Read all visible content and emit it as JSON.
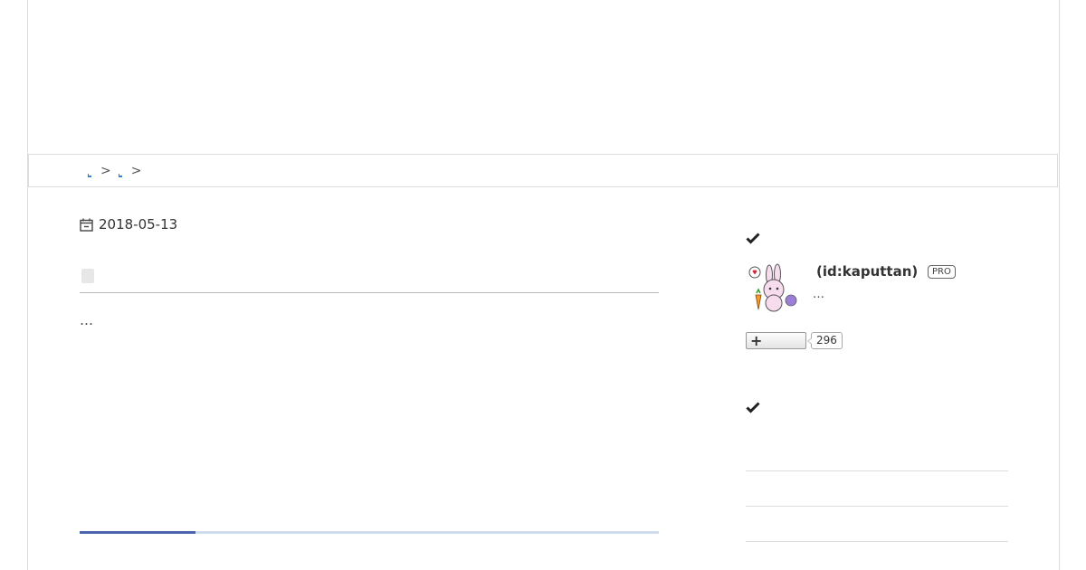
{
  "breadcrumb": {
    "items": [
      {
        "label": "",
        "separator": ">"
      },
      {
        "label": "",
        "separator": ">"
      }
    ]
  },
  "article": {
    "date": "2018-05-13",
    "excerpt": "…",
    "read_progress": 0.2
  },
  "sidebar": {
    "profile_section_icon": "check-icon",
    "profile": {
      "id_text": "(id:kaputtan)",
      "badge": "PRO",
      "description": "…",
      "follow_count": "296",
      "follow_icon": "plus-icon"
    },
    "second_section_icon": "check-icon"
  },
  "colors": {
    "link": "#3a7fd5",
    "progress_fill": "#4a64ad",
    "progress_track": "#cfdcee",
    "border": "#dddddd"
  }
}
